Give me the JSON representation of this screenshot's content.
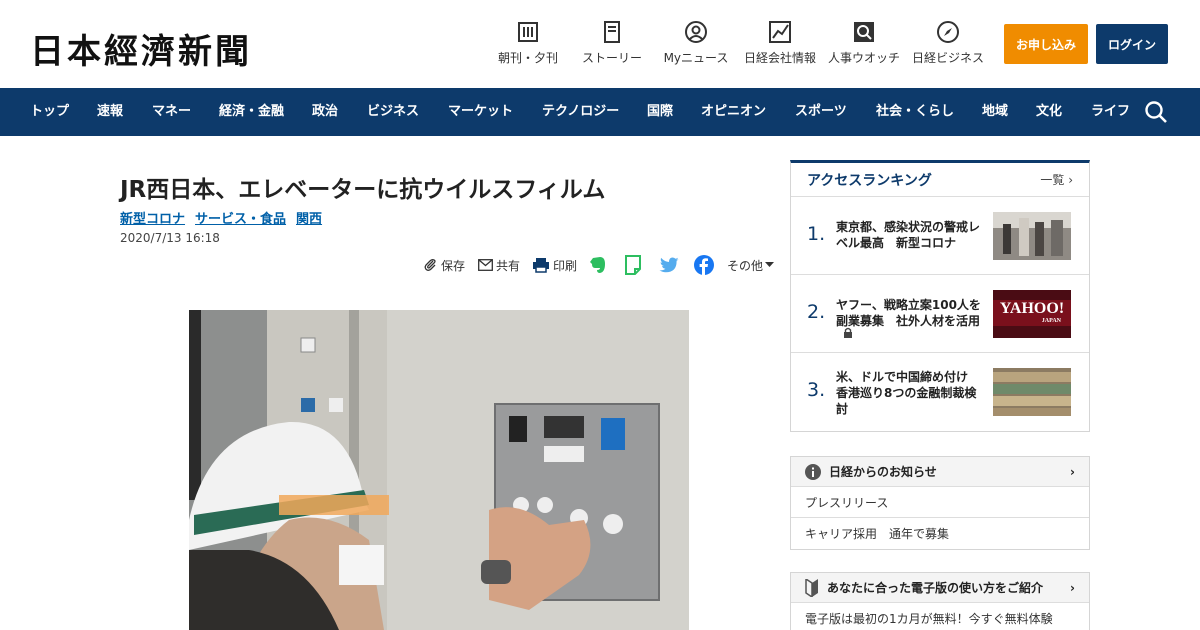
{
  "header": {
    "logo": "日本經濟新聞",
    "nav": [
      {
        "label": "朝刊・夕刊",
        "icon": "newspaper-icon"
      },
      {
        "label": "ストーリー",
        "icon": "story-icon"
      },
      {
        "label": "Myニュース",
        "icon": "user-icon"
      },
      {
        "label": "日経会社情報",
        "icon": "chart-icon"
      },
      {
        "label": "人事ウオッチ",
        "icon": "search-person-icon"
      },
      {
        "label": "日経ビジネス",
        "icon": "compass-icon"
      }
    ],
    "subscribe_label": "お申し込み",
    "login_label": "ログイン"
  },
  "main_nav": [
    "トップ",
    "速報",
    "マネー",
    "経済・金融",
    "政治",
    "ビジネス",
    "マーケット",
    "テクノロジー",
    "国際",
    "オピニオン",
    "スポーツ",
    "社会・くらし",
    "地域",
    "文化",
    "ライフ"
  ],
  "article": {
    "title": "JR西日本、エレベーターに抗ウイルスフィルム",
    "tags": [
      "新型コロナ",
      "サービス・食品",
      "関西"
    ],
    "date": "2020/7/13 16:18",
    "tools": {
      "save": "保存",
      "share": "共有",
      "print": "印刷",
      "other": "その他"
    }
  },
  "ranking": {
    "title": "アクセスランキング",
    "more": "一覧",
    "items": [
      {
        "num": "1.",
        "text": "東京都、感染状況の警戒レベル最高　新型コロナ"
      },
      {
        "num": "2.",
        "text": "ヤフー、戦略立案100人を副業募集　社外人材を活用"
      },
      {
        "num": "3.",
        "text": "米、ドルで中国締め付け　香港巡り8つの金融制裁検討"
      }
    ],
    "yahoo_logo": "YAHOO!",
    "yahoo_sub": "JAPAN"
  },
  "notices": {
    "title": "日経からのお知らせ",
    "items": [
      "プレスリリース",
      "キャリア採用　通年で募集"
    ]
  },
  "guide": {
    "title": "あなたに合った電子版の使い方をご紹介",
    "items": [
      "電子版は最初の1カ月が無料！今すぐ無料体験"
    ]
  },
  "colors": {
    "navy": "#0d3a6b",
    "orange": "#f08c00",
    "link": "#0060a8"
  }
}
